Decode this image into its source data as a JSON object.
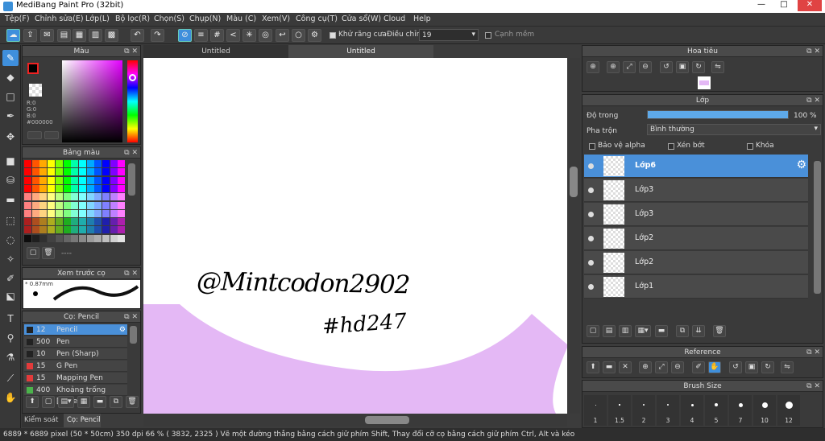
{
  "window": {
    "title": "MediBang Paint Pro (32bit)",
    "buttons": [
      "—",
      "□",
      "✕"
    ]
  },
  "menu": [
    "Tệp(F)",
    "Chỉnh sửa(E)",
    "Lớp(L)",
    "Bộ lọc(R)",
    "Chọn(S)",
    "Chụp(N)",
    "Màu (C)",
    "Xem(V)",
    "Công cụ(T)",
    "Cửa sổ(W)",
    "Cloud",
    "Help"
  ],
  "toolbar": {
    "antialias_label": "Khử răng cưa",
    "correction_label": "Điều chỉnh",
    "correction_value": "19",
    "smooth_label": "Cạnh mềm"
  },
  "tabs": [
    "Untitled",
    "Untitled"
  ],
  "color_panel": {
    "title": "Màu",
    "r": "R:0",
    "g": "G:0",
    "b": "B:0",
    "hex": "#000000"
  },
  "palette_panel": {
    "title": "Bảng màu",
    "footer": "----"
  },
  "brush_preview": {
    "title": "Xem trước cọ",
    "size": "* 0.87mm"
  },
  "brush_panel": {
    "title": "Cọ: Pencil",
    "items": [
      {
        "size": "12",
        "name": "Pencil",
        "color": "#222222"
      },
      {
        "size": "500",
        "name": "Pen",
        "color": "#222222"
      },
      {
        "size": "10",
        "name": "Pen (Sharp)",
        "color": "#222222"
      },
      {
        "size": "15",
        "name": "G Pen",
        "color": "#e33b3b"
      },
      {
        "size": "15",
        "name": "Mapping Pen",
        "color": "#e33b3b"
      },
      {
        "size": "400",
        "name": "Khoảng trống [Edge I",
        "color": "#4bb34b"
      }
    ]
  },
  "bottom_tabs": [
    "Kiểm soát cọ",
    "Cọ: Pencil"
  ],
  "canvas_text": {
    "line1": "@Mintcodon2902",
    "line2": "#hd247"
  },
  "navigator": {
    "title": "Hoa tiêu"
  },
  "layer_panel": {
    "title": "Lớp",
    "opacity_label": "Độ trong",
    "opacity_value": "100 %",
    "opacity": 1.0,
    "blend_label": "Pha trộn",
    "blend_value": "Bình thường",
    "protect_alpha": "Bảo vệ alpha",
    "clipping": "Xén bớt",
    "lock": "Khóa",
    "layers": [
      "Lớp6",
      "Lớp3",
      "Lớp3",
      "Lớp2",
      "Lớp2",
      "Lớp1"
    ]
  },
  "reference": {
    "title": "Reference"
  },
  "brush_size": {
    "title": "Brush Size",
    "sizes": [
      "1",
      "1.5",
      "2",
      "3",
      "4",
      "5",
      "7",
      "10",
      "12"
    ]
  },
  "status": "6889 * 6889 pixel  (50 * 50cm)  350 dpi  66 %  ( 3832, 2325 )  Vẽ một đường thẳng bằng cách giữ phím Shift, Thay đổi cỡ cọ bằng cách giữ phím Ctrl, Alt và kéo",
  "colors": {
    "accent": "#3f8fdc",
    "lavender": "#e4b8f5",
    "panel": "#3a3a3a"
  }
}
